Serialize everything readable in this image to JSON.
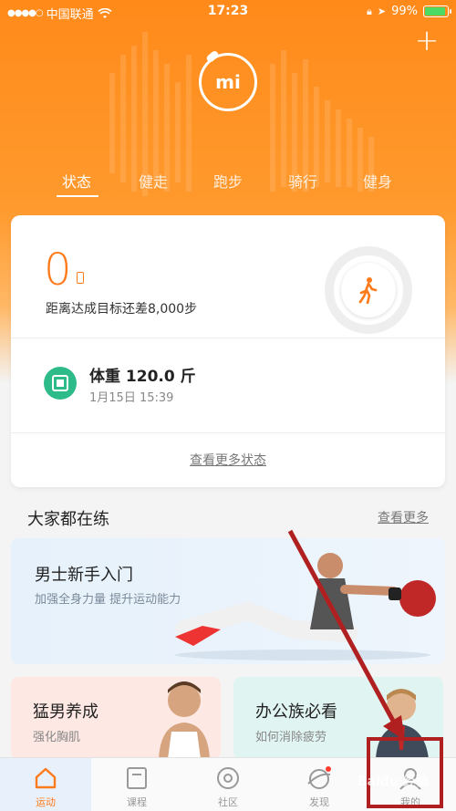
{
  "status_bar": {
    "carrier": "中国联通",
    "time": "17:23",
    "battery": "99%"
  },
  "header": {
    "logo_text": "mi",
    "tabs": [
      {
        "label": "状态",
        "active": true
      },
      {
        "label": "健走"
      },
      {
        "label": "跑步"
      },
      {
        "label": "骑行"
      },
      {
        "label": "健身"
      }
    ]
  },
  "status_card": {
    "steps": "0",
    "steps_desc": "距离达成目标还差8,000步",
    "weight_title": "体重 120.0 斤",
    "weight_time": "1月15日 15:39",
    "more_label": "查看更多状态"
  },
  "section": {
    "title": "大家都在练",
    "more": "查看更多"
  },
  "courses": [
    {
      "title": "男士新手入门",
      "sub": "加强全身力量 提升运动能力"
    },
    {
      "title": "猛男养成",
      "sub": "强化胸肌"
    },
    {
      "title": "办公族必看",
      "sub": "如何消除疲劳"
    }
  ],
  "tabbar": [
    {
      "label": "运动",
      "icon": "home-icon",
      "active": true
    },
    {
      "label": "课程",
      "icon": "course-icon"
    },
    {
      "label": "社区",
      "icon": "community-icon"
    },
    {
      "label": "发现",
      "icon": "discover-icon"
    },
    {
      "label": "我的",
      "icon": "profile-icon"
    }
  ],
  "watermark": "Baidu 经验",
  "colors": {
    "accent": "#ff7a1a",
    "header_orange": "#ff8a1a",
    "weight_green": "#2dbb8a",
    "annotation_red": "#b02020"
  }
}
